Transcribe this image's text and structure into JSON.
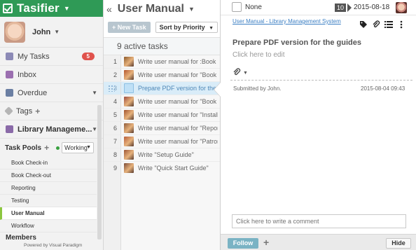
{
  "app": {
    "title": "Tasifier"
  },
  "user": {
    "name": "John"
  },
  "nav": [
    {
      "label": "My Tasks",
      "badge": "5",
      "icon": "tasks-icon",
      "color": "#8c8ab6"
    },
    {
      "label": "Inbox",
      "icon": "inbox-icon",
      "color": "#9b6fb0"
    },
    {
      "label": "Overdue",
      "icon": "overdue-icon",
      "color": "#6b7fa3"
    },
    {
      "label": "Tags",
      "icon": "tag-icon",
      "color": "#9a9a9a"
    }
  ],
  "project": {
    "name": "Library Manageme..."
  },
  "pools": {
    "label": "Task Pools",
    "filter": "Working",
    "items": [
      "Book Check-in",
      "Book Check-out",
      "Reporting",
      "Testing",
      "User Manual",
      "Workflow"
    ],
    "active_index": 4
  },
  "sidebar_footer": {
    "members": "Members",
    "powered": "Powered by Visual Paradigm"
  },
  "list": {
    "title": "User Manual",
    "new_task": "+ New Task",
    "sort": "Sort by Priority",
    "count": "9 active tasks",
    "tasks": [
      {
        "num": "1",
        "text": "Write user manual for :Book C"
      },
      {
        "num": "2",
        "text": "Write user manual for \"Book C"
      },
      {
        "num": "3",
        "text": "Prepare PDF version for the"
      },
      {
        "num": "4",
        "text": "Write user manual for \"Book S"
      },
      {
        "num": "5",
        "text": "Write user manual for \"Installa"
      },
      {
        "num": "6",
        "text": "Write user manual for \"Report"
      },
      {
        "num": "7",
        "text": "Write user manual for \"Patron"
      },
      {
        "num": "8",
        "text": "Write \"Setup Guide\""
      },
      {
        "num": "9",
        "text": "Write \"Quick Start Guide\""
      }
    ],
    "selected_index": 2
  },
  "detail": {
    "assignee": "None",
    "points": "10",
    "date": "2015-08-18",
    "breadcrumb": "User Manual - Library Management System",
    "title": "Prepare PDF version for the guides",
    "description_placeholder": "Click here to edit",
    "submitted": "Submitted by John.",
    "timestamp": "2015-08-04 09:43",
    "comment_placeholder": "Click here to write a comment",
    "follow": "Follow",
    "hide": "Hide"
  },
  "colors": {
    "brand": "#2f9a56",
    "badge": "#e0524c",
    "selected_row": "#d9ecf8",
    "link": "#3a7ec3",
    "follow": "#7ab3c4"
  }
}
